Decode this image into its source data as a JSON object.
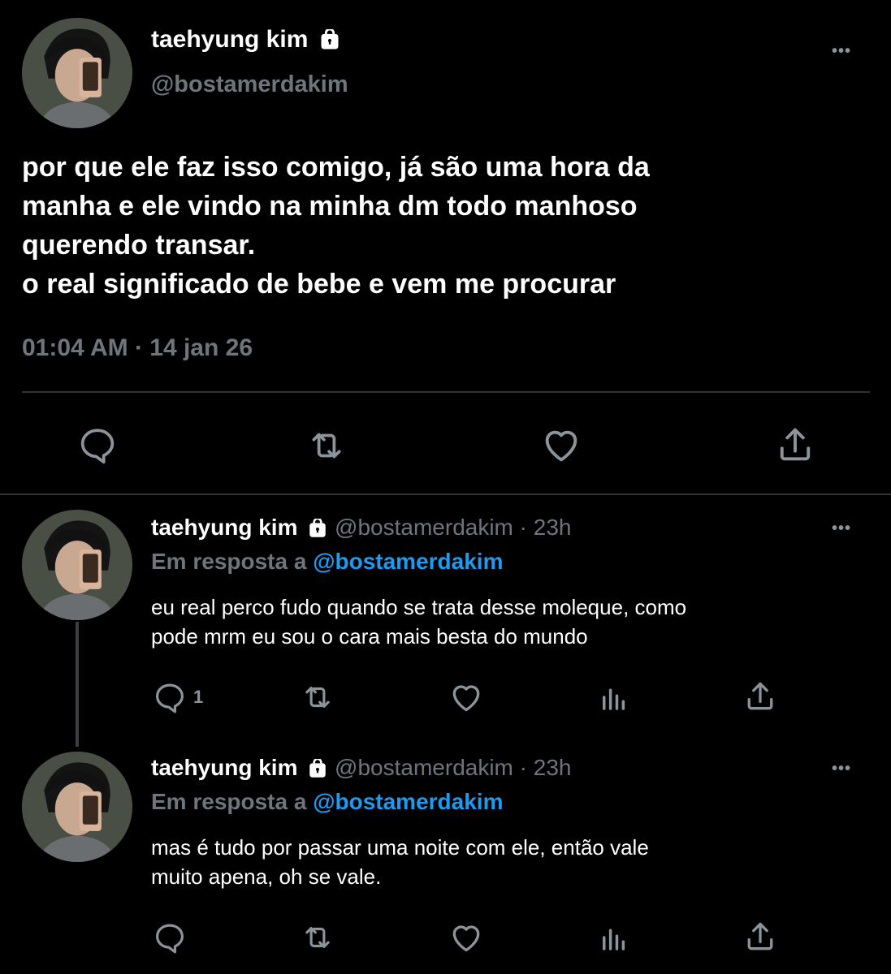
{
  "main_tweet": {
    "author_name": "taehyung kim",
    "handle": "@bostamerdakim",
    "text_lines": [
      "por que ele faz isso comigo, já são uma hora da",
      "manha e ele vindo na minha dm todo manhoso",
      "querendo transar.",
      "o real significado de bebe e vem me procurar"
    ],
    "timestamp": "01:04 AM · 14 jan 26",
    "more_label": "•••"
  },
  "replies": [
    {
      "author_name": "taehyung kim",
      "handle": "@bostamerdakim",
      "age": "· 23h",
      "in_reply_prefix": "Em resposta a",
      "in_reply_handle": "@bostamerdakim",
      "text_lines": [
        "eu real perco fudo quando se trata desse moleque, como",
        "pode mrm eu sou o cara mais besta do mundo"
      ],
      "reply_count": "1",
      "more_label": "•••"
    },
    {
      "author_name": "taehyung kim",
      "handle": "@bostamerdakim",
      "age": "· 23h",
      "in_reply_prefix": "Em resposta a",
      "in_reply_handle": "@bostamerdakim",
      "text_lines": [
        "mas é tudo por passar uma noite com ele, então vale",
        "muito apena, oh se vale."
      ],
      "reply_count": "",
      "more_label": "•••"
    }
  ],
  "colors": {
    "background": "#000000",
    "text": "#ffffff",
    "secondary": "#6e767d",
    "link": "#1d9bf0",
    "divider": "#2f3336"
  },
  "icons": [
    "lock-icon",
    "more-icon",
    "reply-icon",
    "retweet-icon",
    "like-icon",
    "share-icon",
    "analytics-icon"
  ]
}
